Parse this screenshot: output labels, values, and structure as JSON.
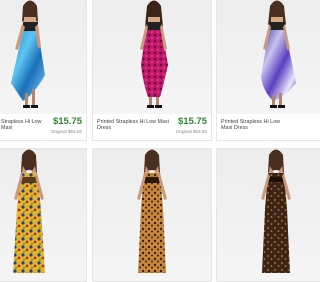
{
  "products": [
    {
      "title": "Printed Strapless Hi Low Maxi Dress",
      "title_visible": "Strapless Hi Low Maxi",
      "price": "$15.75",
      "original_price": "Original $63.00",
      "pattern": "blue-tie-dye"
    },
    {
      "title": "Printed Strapless Hi Low Maxi Dress",
      "price": "$15.75",
      "original_price": "Original $63.00",
      "pattern": "pink-animal-print"
    },
    {
      "title": "Printed Strapless Hi Low Maxi Dress",
      "pattern": "purple-floral-print"
    },
    {
      "pattern": "yellow-paisley-halter"
    },
    {
      "pattern": "leopard-print-halter"
    },
    {
      "pattern": "brown-print-halter"
    }
  ],
  "colors": {
    "price_green": "#2b8a2e",
    "card_border": "#e6e6e6"
  }
}
